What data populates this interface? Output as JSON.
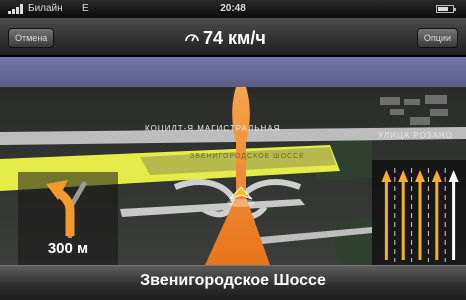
{
  "status_bar": {
    "carrier": "Билайн",
    "network": "E",
    "time": "20:48",
    "battery_fraction": 0.7
  },
  "topbar": {
    "cancel_label": "Отмена",
    "speed": "74 км/ч",
    "options_label": "Опции"
  },
  "map": {
    "street_labels": {
      "main_road": "КОЦИЛТ-Я МАГИСТРАЛЬНАЯ",
      "right_street": "УЛИЦА РОЗАНО",
      "highlighted_road": "ЗВЕНИГОРОДСКОЕ ШОССЕ"
    },
    "colors": {
      "route": "#f28a2e",
      "highlight_road": "#e5ec4a",
      "sky": "#6b6e9c",
      "ground": "#343634"
    }
  },
  "turn_panel": {
    "icon": "bear-left-arrow-icon",
    "distance": "300 м"
  },
  "lanes": {
    "icon": "lane-guidance-icon",
    "count": 5,
    "active_lanes": [
      1,
      2,
      3
    ]
  },
  "bottom_bar": {
    "street_name": "Звенигородское Шоссе"
  }
}
